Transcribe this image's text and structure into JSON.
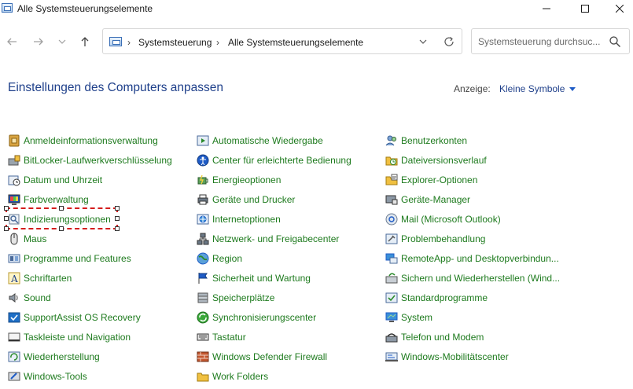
{
  "window": {
    "title": "Alle Systemsteuerungselemente"
  },
  "address": {
    "crumbs": [
      "Systemsteuerung",
      "Alle Systemsteuerungselemente"
    ]
  },
  "search": {
    "placeholder": "Systemsteuerung durchsuc..."
  },
  "header": {
    "title": "Einstellungen des Computers anpassen",
    "view_label": "Anzeige:",
    "view_value": "Kleine Symbole"
  },
  "colors": {
    "link_green": "#1d7a1d",
    "heading_blue": "#1e3f8a",
    "selection_red": "#d41d1d"
  },
  "columns": [
    [
      {
        "label": "Anmeldeinformationsverwaltung",
        "icon": "credential-manager-icon"
      },
      {
        "label": "BitLocker-Laufwerkverschlüsselung",
        "icon": "bitlocker-icon"
      },
      {
        "label": "Datum und Uhrzeit",
        "icon": "datetime-icon"
      },
      {
        "label": "Farbverwaltung",
        "icon": "color-management-icon"
      },
      {
        "label": "Indizierungsoptionen",
        "icon": "indexing-icon"
      },
      {
        "label": "Maus",
        "icon": "mouse-icon"
      },
      {
        "label": "Programme und Features",
        "icon": "programs-icon"
      },
      {
        "label": "Schriftarten",
        "icon": "fonts-icon"
      },
      {
        "label": "Sound",
        "icon": "sound-icon"
      },
      {
        "label": "SupportAssist OS Recovery",
        "icon": "supportassist-icon"
      },
      {
        "label": "Taskleiste und Navigation",
        "icon": "taskbar-icon"
      },
      {
        "label": "Wiederherstellung",
        "icon": "recovery-icon"
      },
      {
        "label": "Windows-Tools",
        "icon": "windows-tools-icon"
      }
    ],
    [
      {
        "label": "Automatische Wiedergabe",
        "icon": "autoplay-icon"
      },
      {
        "label": "Center für erleichterte Bedienung",
        "icon": "ease-of-access-icon"
      },
      {
        "label": "Energieoptionen",
        "icon": "power-icon"
      },
      {
        "label": "Geräte und Drucker",
        "icon": "devices-printers-icon"
      },
      {
        "label": "Internetoptionen",
        "icon": "internet-options-icon"
      },
      {
        "label": "Netzwerk- und Freigabecenter",
        "icon": "network-icon"
      },
      {
        "label": "Region",
        "icon": "region-icon"
      },
      {
        "label": "Sicherheit und Wartung",
        "icon": "security-flag-icon"
      },
      {
        "label": "Speicherplätze",
        "icon": "storage-spaces-icon"
      },
      {
        "label": "Synchronisierungscenter",
        "icon": "sync-center-icon"
      },
      {
        "label": "Tastatur",
        "icon": "keyboard-icon"
      },
      {
        "label": "Windows Defender Firewall",
        "icon": "firewall-icon"
      },
      {
        "label": "Work Folders",
        "icon": "work-folders-icon"
      }
    ],
    [
      {
        "label": "Benutzerkonten",
        "icon": "user-accounts-icon"
      },
      {
        "label": "Dateiversionsverlauf",
        "icon": "file-history-icon"
      },
      {
        "label": "Explorer-Optionen",
        "icon": "explorer-options-icon"
      },
      {
        "label": "Geräte-Manager",
        "icon": "device-manager-icon"
      },
      {
        "label": "Mail (Microsoft Outlook)",
        "icon": "mail-icon"
      },
      {
        "label": "Problembehandlung",
        "icon": "troubleshooting-icon"
      },
      {
        "label": "RemoteApp- und Desktopverbindun...",
        "icon": "remoteapp-icon"
      },
      {
        "label": "Sichern und Wiederherstellen (Wind...",
        "icon": "backup-icon"
      },
      {
        "label": "Standardprogramme",
        "icon": "default-programs-icon"
      },
      {
        "label": "System",
        "icon": "system-icon"
      },
      {
        "label": "Telefon und Modem",
        "icon": "phone-modem-icon"
      },
      {
        "label": "Windows-Mobilitätscenter",
        "icon": "mobility-center-icon"
      }
    ]
  ]
}
